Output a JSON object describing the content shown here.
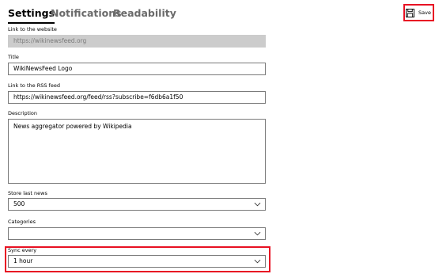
{
  "tabs": [
    {
      "label": "Settings",
      "active": true
    },
    {
      "label": "Notifications",
      "active": false
    },
    {
      "label": "Readability",
      "active": false
    }
  ],
  "toolbar": {
    "save_label": "Save",
    "save_icon": "save-icon"
  },
  "form": {
    "website": {
      "label": "Link to the website",
      "value": "https://wikinewsfeed.org"
    },
    "title": {
      "label": "Title",
      "value": "WikiNewsFeed Logo"
    },
    "rss": {
      "label": "Link to the RSS feed",
      "value": "https://wikinewsfeed.org/feed/rss?subscribe=f6db6a1f50"
    },
    "description": {
      "label": "Description",
      "value": "News aggregator powered by Wikipedia"
    },
    "store_last_news": {
      "label": "Store last news",
      "value": "500"
    },
    "categories": {
      "label": "Categories",
      "value": ""
    },
    "sync_every": {
      "label": "Sync every",
      "value": "1 hour"
    }
  },
  "colors": {
    "highlight": "#e81123",
    "disabled_field": "#cccccc",
    "inactive_tab": "#6a6a6a"
  }
}
